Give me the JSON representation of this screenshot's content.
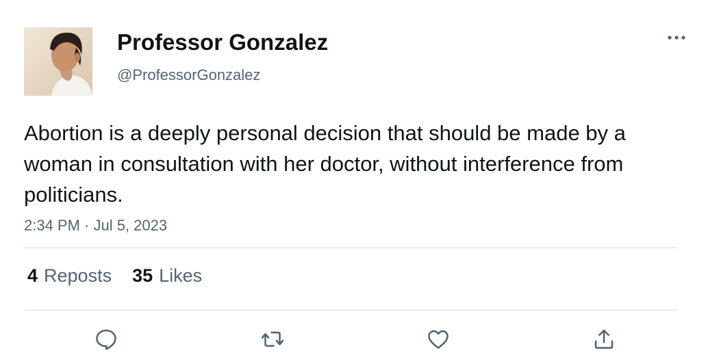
{
  "author": {
    "display_name": "Professor Gonzalez",
    "handle": "@ProfessorGonzalez"
  },
  "tweet": {
    "text": "Abortion is a deeply personal decision that should be made by a woman in consultation with her doctor, without interference from politicians.",
    "timestamp": "2:34 PM · Jul 5, 2023"
  },
  "stats": {
    "reposts_count": "4",
    "reposts_label": "Reposts",
    "likes_count": "35",
    "likes_label": "Likes"
  },
  "icons": {
    "more": "more-horizontal-icon",
    "reply": "reply-icon",
    "repost": "repost-icon",
    "like": "heart-icon",
    "share": "share-icon"
  },
  "colors": {
    "text_primary": "#0f1419",
    "text_secondary": "#536471",
    "divider": "#cfd9de"
  }
}
